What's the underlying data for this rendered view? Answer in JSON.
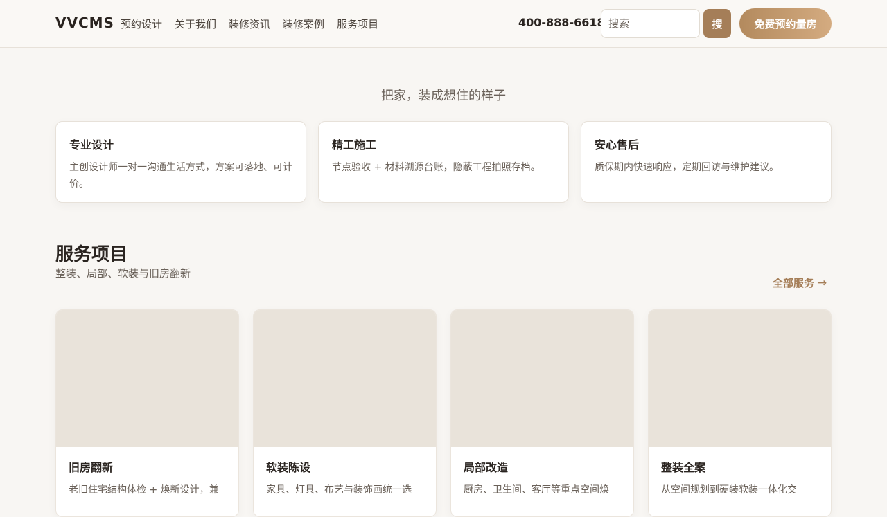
{
  "header": {
    "logo": "VVCMS",
    "nav": [
      "预约设计",
      "关于我们",
      "装修资讯",
      "装修案例",
      "服务项目"
    ],
    "phone": "400-888-6618",
    "search_placeholder": "搜索",
    "search_button": "搜",
    "cta": "免费预约量房"
  },
  "hero": {
    "slogan": "把家，装成想住的样子"
  },
  "features": [
    {
      "title": "专业设计",
      "desc": "主创设计师一对一沟通生活方式，方案可落地、可计价。"
    },
    {
      "title": "精工施工",
      "desc": "节点验收 + 材料溯源台账，隐蔽工程拍照存档。"
    },
    {
      "title": "安心售后",
      "desc": "质保期内快速响应，定期回访与维护建议。"
    }
  ],
  "services_section": {
    "title": "服务项目",
    "subtitle": "整装、局部、软装与旧房翻新",
    "all_link": "全部服务",
    "arrow": "→",
    "items": [
      {
        "title": "旧房翻新",
        "desc": "老旧住宅结构体检 + 焕新设计，兼"
      },
      {
        "title": "软装陈设",
        "desc": "家具、灯具、布艺与装饰画统一选"
      },
      {
        "title": "局部改造",
        "desc": "厨房、卫生间、客厅等重点空间焕"
      },
      {
        "title": "整装全案",
        "desc": "从空间规划到硬装软装一体化交"
      }
    ]
  },
  "colors": {
    "accent": "#a57e58",
    "background": "#f8f6f3",
    "placeholder_image": "#e9e3da"
  }
}
